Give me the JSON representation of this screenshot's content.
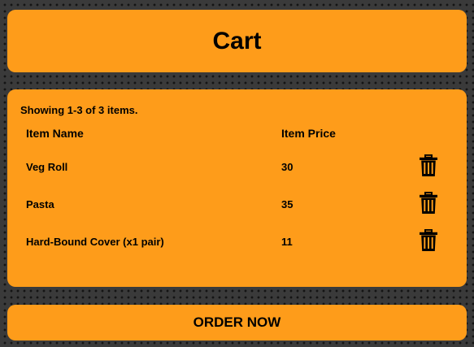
{
  "header": {
    "title": "Cart"
  },
  "cart": {
    "summary": "Showing 1-3 of 3 items.",
    "columns": {
      "name": "Item Name",
      "price": "Item Price"
    },
    "items": [
      {
        "name": "Veg Roll",
        "price": "30",
        "action_icon": "trash-icon"
      },
      {
        "name": "Pasta",
        "price": "35",
        "action_icon": "trash-icon"
      },
      {
        "name": "Hard-Bound Cover (x1 pair)",
        "price": "11",
        "action_icon": "trash-icon"
      }
    ]
  },
  "footer": {
    "order_label": "ORDER NOW"
  },
  "colors": {
    "panel": "#fe9c1a",
    "background": "#3a3a3a",
    "text": "#000000"
  }
}
